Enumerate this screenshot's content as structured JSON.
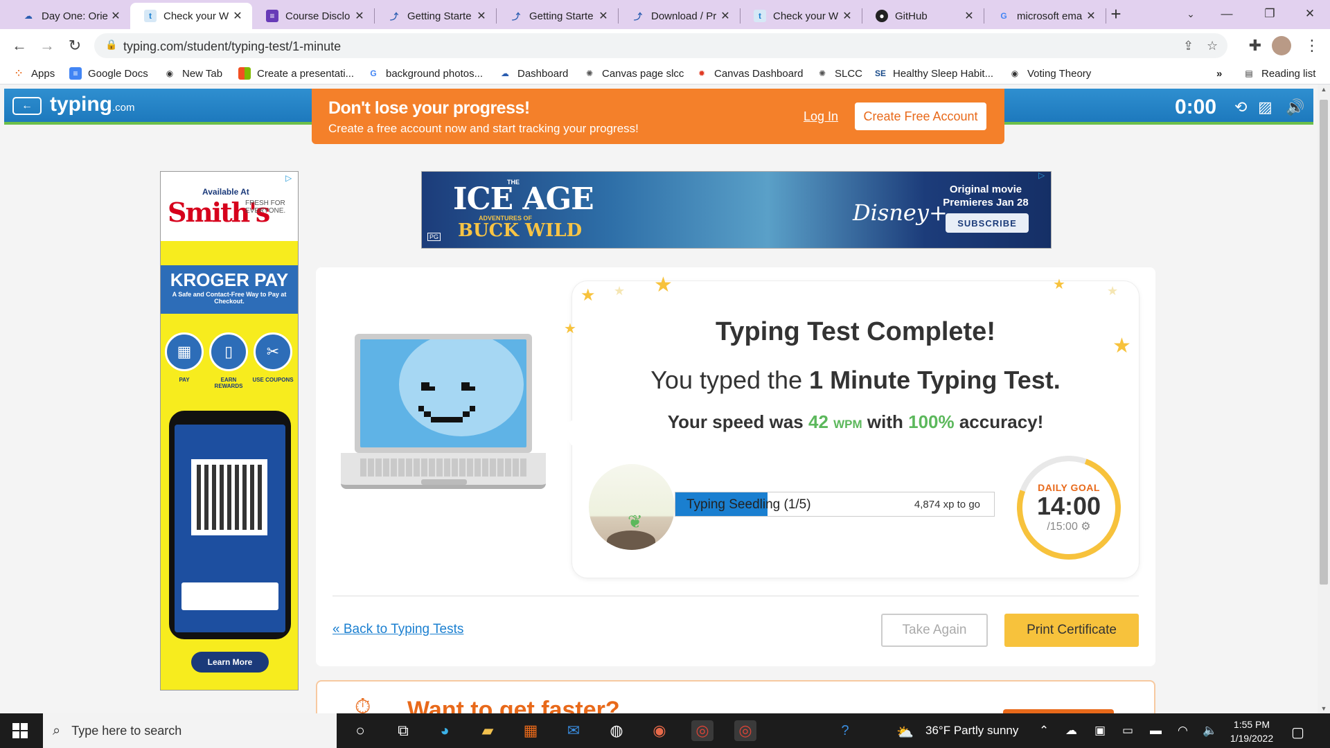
{
  "browser": {
    "tabs": [
      {
        "title": "Day One: Orie",
        "icon": "canvas-icon",
        "active": false
      },
      {
        "title": "Check your W",
        "icon": "typing-icon",
        "active": true
      },
      {
        "title": "Course Disclo",
        "icon": "forms-icon",
        "active": false
      },
      {
        "title": "Getting Starte",
        "icon": "confluence-icon",
        "active": false
      },
      {
        "title": "Getting Starte",
        "icon": "confluence-icon",
        "active": false
      },
      {
        "title": "Download / Pr",
        "icon": "confluence-icon",
        "active": false
      },
      {
        "title": "Check your W",
        "icon": "typing-icon",
        "active": false
      },
      {
        "title": "GitHub",
        "icon": "github-icon",
        "active": false
      },
      {
        "title": "microsoft ema",
        "icon": "google-icon",
        "active": false
      }
    ],
    "url": "typing.com/student/typing-test/1-minute",
    "bookmarks": [
      {
        "label": "Apps",
        "icon": "apps-grid-icon"
      },
      {
        "label": "Google Docs",
        "icon": "docs-icon"
      },
      {
        "label": "New Tab",
        "icon": "globe-icon"
      },
      {
        "label": "Create a presentati...",
        "icon": "microsoft-icon"
      },
      {
        "label": "background photos...",
        "icon": "google-icon"
      },
      {
        "label": "Dashboard",
        "icon": "canvas-icon"
      },
      {
        "label": "Canvas page slcc",
        "icon": "canvas-icon"
      },
      {
        "label": "Canvas Dashboard",
        "icon": "canvas-icon"
      },
      {
        "label": "SLCC",
        "icon": "canvas-icon"
      },
      {
        "label": "Healthy Sleep Habit...",
        "icon": "se-icon"
      },
      {
        "label": "Voting Theory",
        "icon": "globe-icon"
      }
    ],
    "bookmarks_overflow": "»",
    "reading_list": "Reading list"
  },
  "site": {
    "logo": "typing",
    "logo_suffix": ".com",
    "timer": "0:00",
    "promo": {
      "headline": "Don't lose your progress!",
      "subtext": "Create a free account now and start tracking your progress!",
      "login": "Log In",
      "create": "Create Free Account"
    }
  },
  "ads": {
    "left": {
      "available": "Available At",
      "brand": "Smith's",
      "tagline": "FRESH FOR EVERYONE.",
      "kroger_title": "KROGER PAY",
      "kroger_sub": "A Safe and Contact-Free Way to Pay at Checkout.",
      "steps": [
        "PAY",
        "EARN REWARDS",
        "USE COUPONS"
      ],
      "learn_more": "Learn More"
    },
    "top": {
      "the": "THE",
      "title": "ICE AGE",
      "adventures": "ADVENTURES OF",
      "subtitle": "BUCK WILD",
      "brand": "Disney+",
      "tagline": "Original movie Premieres Jan 28",
      "cta": "SUBSCRIBE",
      "rating": "PG"
    }
  },
  "result": {
    "title": "Typing Test Complete!",
    "line2_prefix": "You typed the ",
    "test_name": "1 Minute Typing Test.",
    "speed_prefix": "Your speed was ",
    "wpm_value": "42",
    "wpm_unit": "WPM",
    "speed_mid": " with ",
    "accuracy": "100%",
    "speed_suffix": " accuracy!",
    "level": {
      "name": "Typing Seedling (1/5)",
      "progress": 0.29,
      "xp_to_go": "4,874 xp to go"
    },
    "goal": {
      "label": "DAILY GOAL",
      "value": "14:00",
      "target": "/15:00"
    },
    "back_link": "« Back to Typing Tests",
    "take_again": "Take Again",
    "print": "Print Certificate"
  },
  "next_section": {
    "title": "Want to get faster?"
  },
  "taskbar": {
    "search_placeholder": "Type here to search",
    "weather": "36°F  Partly sunny",
    "time": "1:55 PM",
    "date": "1/19/2022"
  }
}
